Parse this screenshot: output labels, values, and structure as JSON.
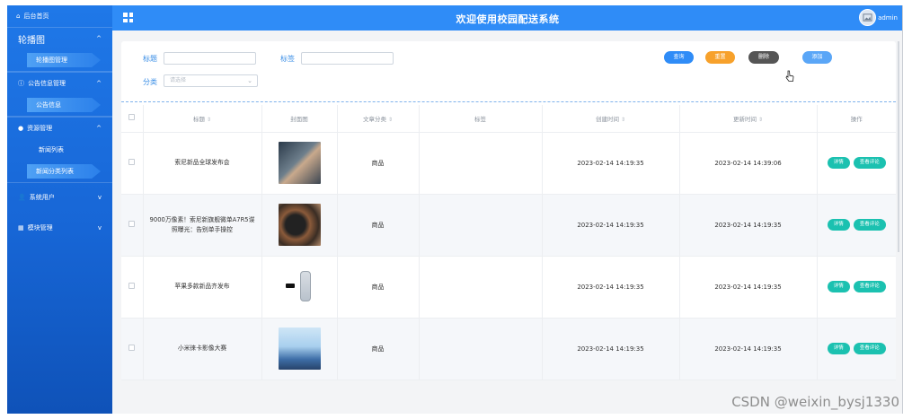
{
  "sidebar": {
    "home_label": "后台首页",
    "groups": [
      {
        "label": "轮播图",
        "sub": [
          "轮播图管理"
        ]
      },
      {
        "label": "公告信息管理",
        "sub": [
          "公告信息"
        ]
      },
      {
        "label": "资源管理",
        "sub": [
          "新闻列表",
          "新闻分类列表"
        ]
      },
      {
        "label": "系统用户",
        "sub": []
      },
      {
        "label": "模块管理",
        "sub": []
      }
    ]
  },
  "header": {
    "title": "欢迎使用校园配送系统",
    "user": "admin"
  },
  "search": {
    "title_label": "标题",
    "tag_label": "标签",
    "category_label": "分类",
    "category_placeholder": "请选择",
    "buttons": {
      "query": "查询",
      "reset": "重置",
      "delete": "删除",
      "add": "添加"
    }
  },
  "table": {
    "headers": [
      "标题",
      "封面图",
      "文章分类",
      "标签",
      "创建时间",
      "更新时间",
      "操作"
    ],
    "rows": [
      {
        "title": "索尼新品全球发布会",
        "category": "商品",
        "tag": "",
        "created": "2023-02-14 14:19:35",
        "updated": "2023-02-14 14:39:06"
      },
      {
        "title": "9000万像素！索尼新旗舰微单A7R5谍照曝光：告别单手操控",
        "category": "商品",
        "tag": "",
        "created": "2023-02-14 14:19:35",
        "updated": "2023-02-14 14:19:35"
      },
      {
        "title": "苹果多款新品齐发布",
        "category": "商品",
        "tag": "",
        "created": "2023-02-14 14:19:35",
        "updated": "2023-02-14 14:19:35"
      },
      {
        "title": "小米徕卡影像大赛",
        "category": "商品",
        "tag": "",
        "created": "2023-02-14 14:19:35",
        "updated": "2023-02-14 14:19:35"
      }
    ],
    "row_actions": {
      "detail": "详情",
      "comments": "查看评论"
    }
  },
  "watermark": "CSDN @weixin_bysj1330",
  "colors": {
    "primary": "#2f8cf7",
    "reset": "#f7a12b",
    "delete": "#555555",
    "teal": "#1bc1b0"
  }
}
